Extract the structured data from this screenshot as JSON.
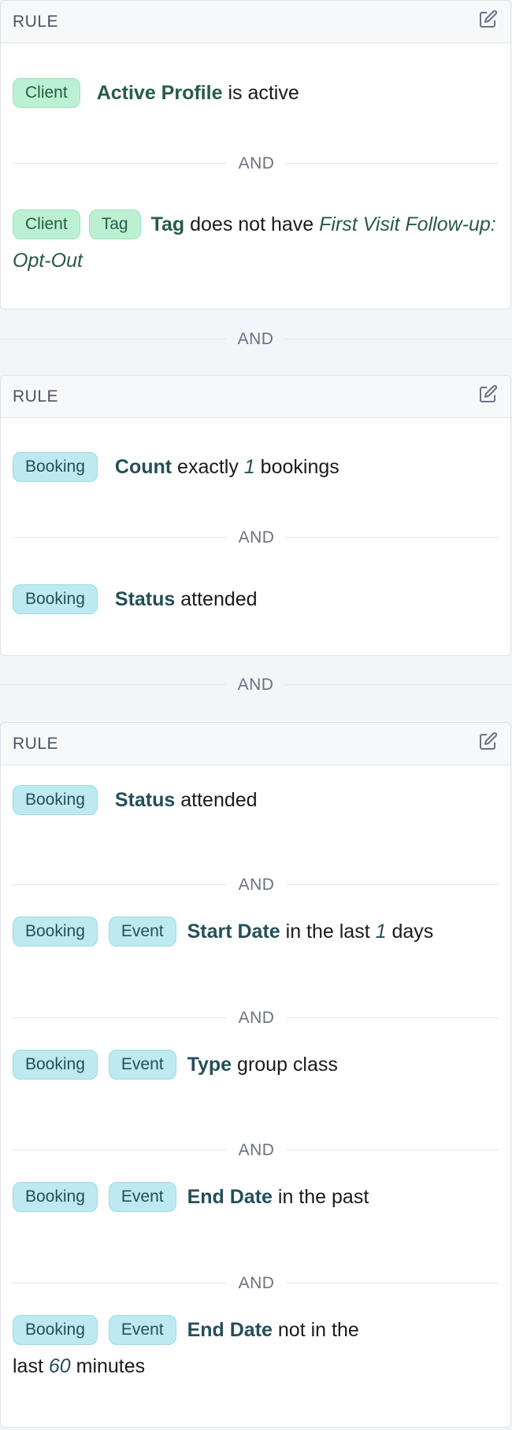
{
  "rule_label": "RULE",
  "and_label": "AND",
  "rules": [
    {
      "conditions": [
        {
          "tags": [
            "Client"
          ],
          "field": "Active Profile",
          "text": "is active"
        },
        {
          "tags": [
            "Client",
            "Tag"
          ],
          "field": "Tag",
          "text": "does not have",
          "value": "First Visit Follow-up: Opt-Out"
        }
      ]
    },
    {
      "conditions": [
        {
          "tags": [
            "Booking"
          ],
          "field": "Count",
          "text_before": "exactly",
          "value": "1",
          "text_after": "bookings"
        },
        {
          "tags": [
            "Booking"
          ],
          "field": "Status",
          "text": "attended"
        }
      ]
    },
    {
      "conditions": [
        {
          "tags": [
            "Booking"
          ],
          "field": "Status",
          "text": "attended"
        },
        {
          "tags": [
            "Booking",
            "Event"
          ],
          "field": "Start Date",
          "text_before": "in the last",
          "value": "1",
          "text_after": "days"
        },
        {
          "tags": [
            "Booking",
            "Event"
          ],
          "field": "Type",
          "text": "group class"
        },
        {
          "tags": [
            "Booking",
            "Event"
          ],
          "field": "End Date",
          "text": "in the past"
        },
        {
          "tags": [
            "Booking",
            "Event"
          ],
          "field": "End Date",
          "text_before": "not in the last",
          "value": "60",
          "text_after": "minutes"
        }
      ]
    }
  ],
  "colors": {
    "client_tag_bg": "#bbf0d3",
    "booking_tag_bg": "#bdeaf0",
    "client_text": "#275c44",
    "booking_text": "#244f58"
  },
  "icons": {
    "edit": "edit-icon"
  }
}
